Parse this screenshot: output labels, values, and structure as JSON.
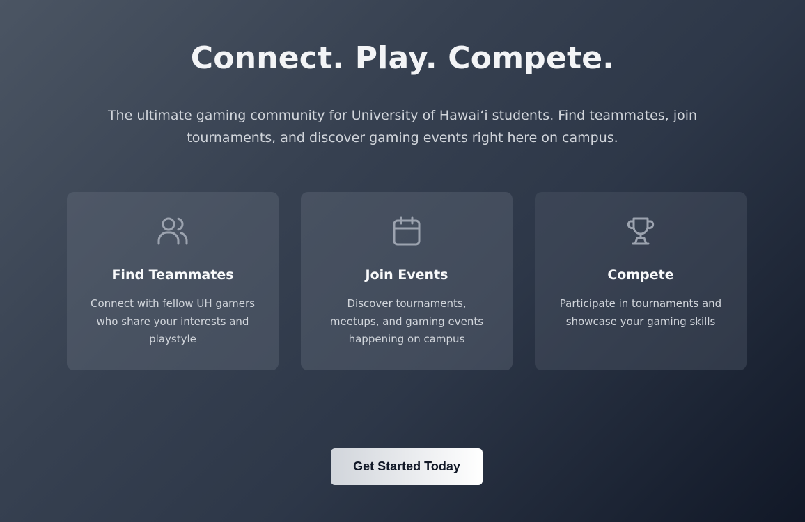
{
  "hero": {
    "headline": "Connect. Play. Compete.",
    "subtitle": "The ultimate gaming community for University of Hawaiʻi students. Find teammates, join tournaments, and discover gaming events right here on campus."
  },
  "features": [
    {
      "icon": "users-icon",
      "title": "Find Teammates",
      "description": "Connect with fellow UH gamers who share your interests and playstyle"
    },
    {
      "icon": "calendar-icon",
      "title": "Join Events",
      "description": "Discover tournaments, meetups, and gaming events happening on campus"
    },
    {
      "icon": "trophy-icon",
      "title": "Compete",
      "description": "Participate in tournaments and showcase your gaming skills"
    }
  ],
  "cta": {
    "label": "Get Started Today"
  },
  "colors": {
    "background_start": "#4b5563",
    "background_end": "#111827",
    "text_primary": "#f3f4f6",
    "text_secondary": "#d1d5db",
    "icon": "#9ca3af"
  }
}
